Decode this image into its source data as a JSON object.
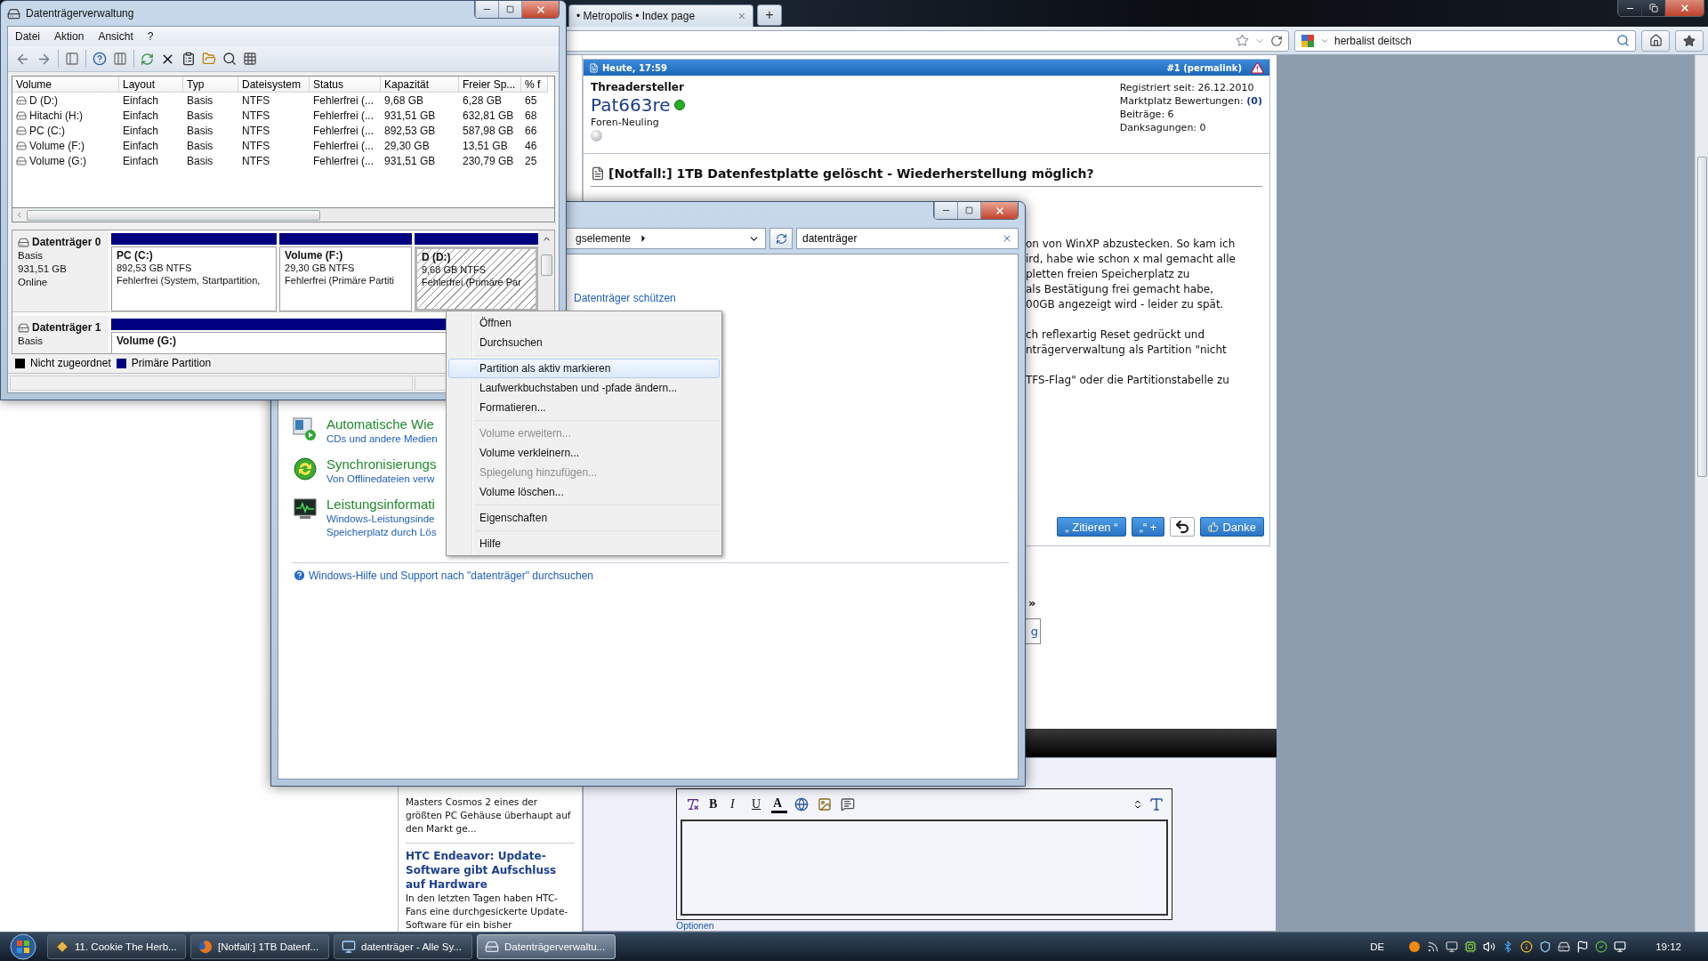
{
  "browser": {
    "tab": {
      "title": "• Metropolis • Index page",
      "close": "×"
    },
    "new_tab": "+",
    "search": {
      "value": "herbalist deitsch"
    }
  },
  "post": {
    "date": "Heute, 17:59",
    "permalink": "#1 (permalink)",
    "role": "Threadersteller",
    "username": "Pat663re",
    "online": true,
    "rank": "Foren-Neuling",
    "stats": [
      "Registriert seit: 26.12.2010",
      "Marktplatz Bewertungen: **(0)**",
      "Beiträge: 6",
      "Danksagungen: 0"
    ],
    "title": "[Notfall:] 1TB Datenfestplatte gelöscht - Wiederherstellung möglich?",
    "paragraphs": [
      [
        "on von WinXP abzustecken. So kam ich",
        "ird, habe wie schon x mal gemacht alle",
        "pletten freien Speicherplatz zu",
        "als Bestätigung frei gemacht habe,",
        "00GB angezeigt wird - leider zu spät."
      ],
      [
        "ch reflexartig Reset gedrückt und",
        "nträgerverwaltung als Partition \"nicht"
      ],
      [
        "TFS-Flag\" oder die Partitionstabelle zu"
      ]
    ],
    "buttons": [
      {
        "kind": "quote",
        "label": "„ Zitieren “"
      },
      {
        "kind": "multiquote",
        "label": "„“ +"
      },
      {
        "kind": "reply"
      },
      {
        "kind": "thanks",
        "label": "Danke"
      }
    ],
    "nav_marker": "»",
    "box_text": "g"
  },
  "sidebar": {
    "teaser": "Masters Cosmos 2 eines der größten PC Gehäuse überhaupt auf den Markt ge...",
    "article": {
      "title": "HTC Endeavor: Update-Software gibt Aufschluss auf Hardware",
      "text": "In den letzten Tagen haben HTC-Fans eine durchgesickerte Update-Software für ein bisher"
    }
  },
  "editor": {
    "buttons": [
      {
        "kind": "clear-format"
      },
      {
        "kind": "bold",
        "label": "B"
      },
      {
        "kind": "italic",
        "label": "I"
      },
      {
        "kind": "underline",
        "label": "U"
      },
      {
        "kind": "color",
        "label": "A"
      },
      {
        "kind": "link"
      },
      {
        "kind": "image"
      },
      {
        "kind": "quote"
      }
    ],
    "options": "Optionen"
  },
  "control_panel": {
    "breadcrumb": "gselemente",
    "search": {
      "value": "datenträger"
    },
    "link": "Datenträger schützen",
    "items": [
      {
        "kind": "autoplay",
        "title": "Automatische Wie",
        "lines": [
          "CDs und andere Medien"
        ]
      },
      {
        "kind": "sync",
        "title": "Synchronisierungs",
        "lines": [
          "Von Offlinedateien verw"
        ]
      },
      {
        "kind": "performance",
        "title": "Leistungsinformati",
        "lines": [
          "Windows-Leistungsinde",
          "Speicherplatz durch Lös"
        ]
      }
    ],
    "help": "Windows-Hilfe und Support nach \"datenträger\" durchsuchen"
  },
  "disk_management": {
    "title": "Datenträgerverwaltung",
    "menu": [
      "Datei",
      "Aktion",
      "Ansicht",
      "?"
    ],
    "columns": [
      "Volume",
      "Layout",
      "Typ",
      "Dateisystem",
      "Status",
      "Kapazität",
      "Freier Sp...",
      "% f"
    ],
    "rows": [
      [
        "D (D:)",
        "Einfach",
        "Basis",
        "NTFS",
        "Fehlerfrei (...",
        "9,68 GB",
        "6,28 GB",
        "65"
      ],
      [
        "Hitachi (H:)",
        "Einfach",
        "Basis",
        "NTFS",
        "Fehlerfrei (...",
        "931,51 GB",
        "632,81 GB",
        "68"
      ],
      [
        "PC (C:)",
        "Einfach",
        "Basis",
        "NTFS",
        "Fehlerfrei (...",
        "892,53 GB",
        "587,98 GB",
        "66"
      ],
      [
        "Volume (F:)",
        "Einfach",
        "Basis",
        "NTFS",
        "Fehlerfrei (...",
        "29,30 GB",
        "13,51 GB",
        "46"
      ],
      [
        "Volume (G:)",
        "Einfach",
        "Basis",
        "NTFS",
        "Fehlerfrei (...",
        "931,51 GB",
        "230,79 GB",
        "25"
      ]
    ],
    "disks": [
      {
        "name": "Datenträger 0",
        "lines": [
          "Basis",
          "931,51 GB",
          "Online"
        ],
        "partitions": [
          {
            "name": "PC (C:)",
            "lines": [
              "892,53 GB NTFS",
              "Fehlerfrei (System, Startpartition,"
            ],
            "selected": false
          },
          {
            "name": "Volume (F:)",
            "lines": [
              "29,30 GB NTFS",
              "Fehlerfrei (Primäre Partiti"
            ],
            "selected": false
          },
          {
            "name": "D (D:)",
            "lines": [
              "9,68 GB NTFS",
              "Fehlerfrei (Primäre Par"
            ],
            "selected": true
          }
        ]
      },
      {
        "name": "Datenträger 1",
        "lines": [
          "Basis"
        ],
        "partitions": [
          {
            "name": "Volume (G:)",
            "selected": false
          }
        ]
      }
    ],
    "legend": [
      {
        "label": "Nicht zugeordnet",
        "color": "#000000"
      },
      {
        "label": "Primäre Partition",
        "color": "#000080"
      }
    ]
  },
  "context_menu": {
    "groups": [
      [
        {
          "label": "Öffnen",
          "selected": false,
          "disabled": false
        },
        {
          "label": "Durchsuchen",
          "selected": false,
          "disabled": false
        }
      ],
      [
        {
          "label": "Partition als aktiv markieren",
          "selected": true,
          "disabled": false
        },
        {
          "label": "Laufwerkbuchstaben und -pfade ändern...",
          "selected": false,
          "disabled": false
        },
        {
          "label": "Formatieren...",
          "selected": false,
          "disabled": false
        }
      ],
      [
        {
          "label": "Volume erweitern...",
          "selected": false,
          "disabled": true
        },
        {
          "label": "Volume verkleinern...",
          "selected": false,
          "disabled": false
        },
        {
          "label": "Spiegelung hinzufügen...",
          "selected": false,
          "disabled": true
        },
        {
          "label": "Volume löschen...",
          "selected": false,
          "disabled": false
        }
      ],
      [
        {
          "label": "Eigenschaften",
          "selected": false,
          "disabled": false
        }
      ],
      [
        {
          "label": "Hilfe",
          "selected": false,
          "disabled": false
        }
      ]
    ]
  },
  "taskbar": {
    "buttons": [
      {
        "kind": "app",
        "label": "11. Cookie The Herb...",
        "selected": false
      },
      {
        "kind": "browser",
        "label": "[Notfall:] 1TB Datenf...",
        "selected": false
      },
      {
        "kind": "control-panel",
        "label": "datenträger - Alle Sy...",
        "selected": false
      },
      {
        "kind": "disk-management",
        "label": "Datenträgerverwaltu...",
        "selected": true
      }
    ],
    "language": "DE",
    "clock": "19:12"
  }
}
